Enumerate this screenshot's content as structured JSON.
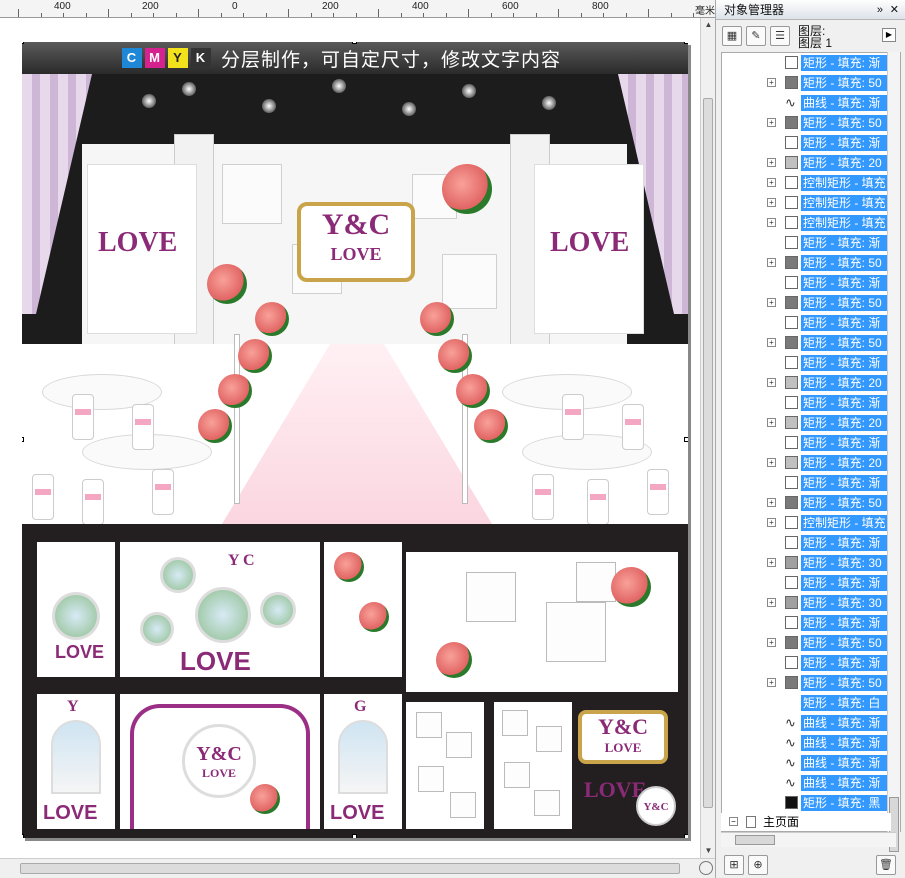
{
  "ruler": {
    "labels": [
      "400",
      "200",
      "0",
      "200",
      "400",
      "600",
      "800"
    ],
    "unit": "毫米"
  },
  "artwork": {
    "banner_text": "分层制作，可自定尺寸，修改文字内容",
    "cmyk": [
      "C",
      "M",
      "Y",
      "K"
    ],
    "backdrop_sign_top": "Y&C",
    "backdrop_sign_bottom": "LOVE",
    "side_love_left": "LOVE",
    "side_love_right": "LOVE",
    "panel1_love": "LOVE",
    "panel2_yc": "Y C",
    "panel2_love": "LOVE",
    "arch1_letter": "Y",
    "arch1_love": "LOVE",
    "center_yc": "Y&C",
    "center_love": "LOVE",
    "arch2_letter": "G",
    "arch2_love": "LOVE",
    "sign_small_top": "Y&C",
    "sign_small_bottom": "LOVE",
    "love_small": "LOVE",
    "badge_yc": "Y&C"
  },
  "object_manager": {
    "title": "对象管理器",
    "layer_caption": "图层:",
    "layer_name": "图层 1",
    "page_label": "主页面",
    "rows": [
      {
        "expand": false,
        "swatch": "#ffffff",
        "kind": "box",
        "label": "矩形 - 填充: 渐"
      },
      {
        "expand": true,
        "swatch": "#7a7a7a",
        "kind": "box",
        "label": "矩形 - 填充: 50"
      },
      {
        "expand": false,
        "swatch": "",
        "kind": "curve",
        "label": "曲线 - 填充: 渐"
      },
      {
        "expand": true,
        "swatch": "#7a7a7a",
        "kind": "box",
        "label": "矩形 - 填充: 50"
      },
      {
        "expand": false,
        "swatch": "#ffffff",
        "kind": "box",
        "label": "矩形 - 填充: 渐"
      },
      {
        "expand": true,
        "swatch": "#c0c0c0",
        "kind": "box",
        "label": "矩形 - 填充: 20"
      },
      {
        "expand": true,
        "swatch": "#ffffff",
        "kind": "box",
        "label": "控制矩形 - 填充"
      },
      {
        "expand": true,
        "swatch": "#ffffff",
        "kind": "box",
        "label": "控制矩形 - 填充"
      },
      {
        "expand": true,
        "swatch": "#ffffff",
        "kind": "box",
        "label": "控制矩形 - 填充"
      },
      {
        "expand": false,
        "swatch": "#ffffff",
        "kind": "box",
        "label": "矩形 - 填充: 渐"
      },
      {
        "expand": true,
        "swatch": "#7a7a7a",
        "kind": "box",
        "label": "矩形 - 填充: 50"
      },
      {
        "expand": false,
        "swatch": "#ffffff",
        "kind": "box",
        "label": "矩形 - 填充: 渐"
      },
      {
        "expand": true,
        "swatch": "#7a7a7a",
        "kind": "box",
        "label": "矩形 - 填充: 50"
      },
      {
        "expand": false,
        "swatch": "#ffffff",
        "kind": "box",
        "label": "矩形 - 填充: 渐"
      },
      {
        "expand": true,
        "swatch": "#7a7a7a",
        "kind": "box",
        "label": "矩形 - 填充: 50"
      },
      {
        "expand": false,
        "swatch": "#ffffff",
        "kind": "box",
        "label": "矩形 - 填充: 渐"
      },
      {
        "expand": true,
        "swatch": "#c0c0c0",
        "kind": "box",
        "label": "矩形 - 填充: 20"
      },
      {
        "expand": false,
        "swatch": "#ffffff",
        "kind": "box",
        "label": "矩形 - 填充: 渐"
      },
      {
        "expand": true,
        "swatch": "#c0c0c0",
        "kind": "box",
        "label": "矩形 - 填充: 20"
      },
      {
        "expand": false,
        "swatch": "#ffffff",
        "kind": "box",
        "label": "矩形 - 填充: 渐"
      },
      {
        "expand": true,
        "swatch": "#c0c0c0",
        "kind": "box",
        "label": "矩形 - 填充: 20"
      },
      {
        "expand": false,
        "swatch": "#ffffff",
        "kind": "box",
        "label": "矩形 - 填充: 渐"
      },
      {
        "expand": true,
        "swatch": "#7a7a7a",
        "kind": "box",
        "label": "矩形 - 填充: 50"
      },
      {
        "expand": true,
        "swatch": "#ffffff",
        "kind": "box",
        "label": "控制矩形 - 填充"
      },
      {
        "expand": false,
        "swatch": "#ffffff",
        "kind": "box",
        "label": "矩形 - 填充: 渐"
      },
      {
        "expand": true,
        "swatch": "#a0a0a0",
        "kind": "box",
        "label": "矩形 - 填充: 30"
      },
      {
        "expand": false,
        "swatch": "#ffffff",
        "kind": "box",
        "label": "矩形 - 填充: 渐"
      },
      {
        "expand": true,
        "swatch": "#a0a0a0",
        "kind": "box",
        "label": "矩形 - 填充: 30"
      },
      {
        "expand": false,
        "swatch": "#ffffff",
        "kind": "box",
        "label": "矩形 - 填充: 渐"
      },
      {
        "expand": true,
        "swatch": "#7a7a7a",
        "kind": "box",
        "label": "矩形 - 填充: 50"
      },
      {
        "expand": false,
        "swatch": "#ffffff",
        "kind": "box",
        "label": "矩形 - 填充: 渐"
      },
      {
        "expand": true,
        "swatch": "#7a7a7a",
        "kind": "box",
        "label": "矩形 - 填充: 50"
      },
      {
        "expand": false,
        "swatch": "#ffffff",
        "kind": "none",
        "label": "矩形 - 填充: 白"
      },
      {
        "expand": false,
        "swatch": "",
        "kind": "curve",
        "label": "曲线 - 填充: 渐"
      },
      {
        "expand": false,
        "swatch": "",
        "kind": "curve",
        "label": "曲线 - 填充: 渐"
      },
      {
        "expand": false,
        "swatch": "",
        "kind": "curve",
        "label": "曲线 - 填充: 渐"
      },
      {
        "expand": false,
        "swatch": "",
        "kind": "curve",
        "label": "曲线 - 填充: 渐"
      },
      {
        "expand": false,
        "swatch": "#111111",
        "kind": "box",
        "label": "矩形 - 填充: 黑"
      }
    ]
  },
  "colors": {
    "accent_purple": "#8b2a77",
    "selection_blue": "#3399ff",
    "gold": "#c9a44a"
  }
}
